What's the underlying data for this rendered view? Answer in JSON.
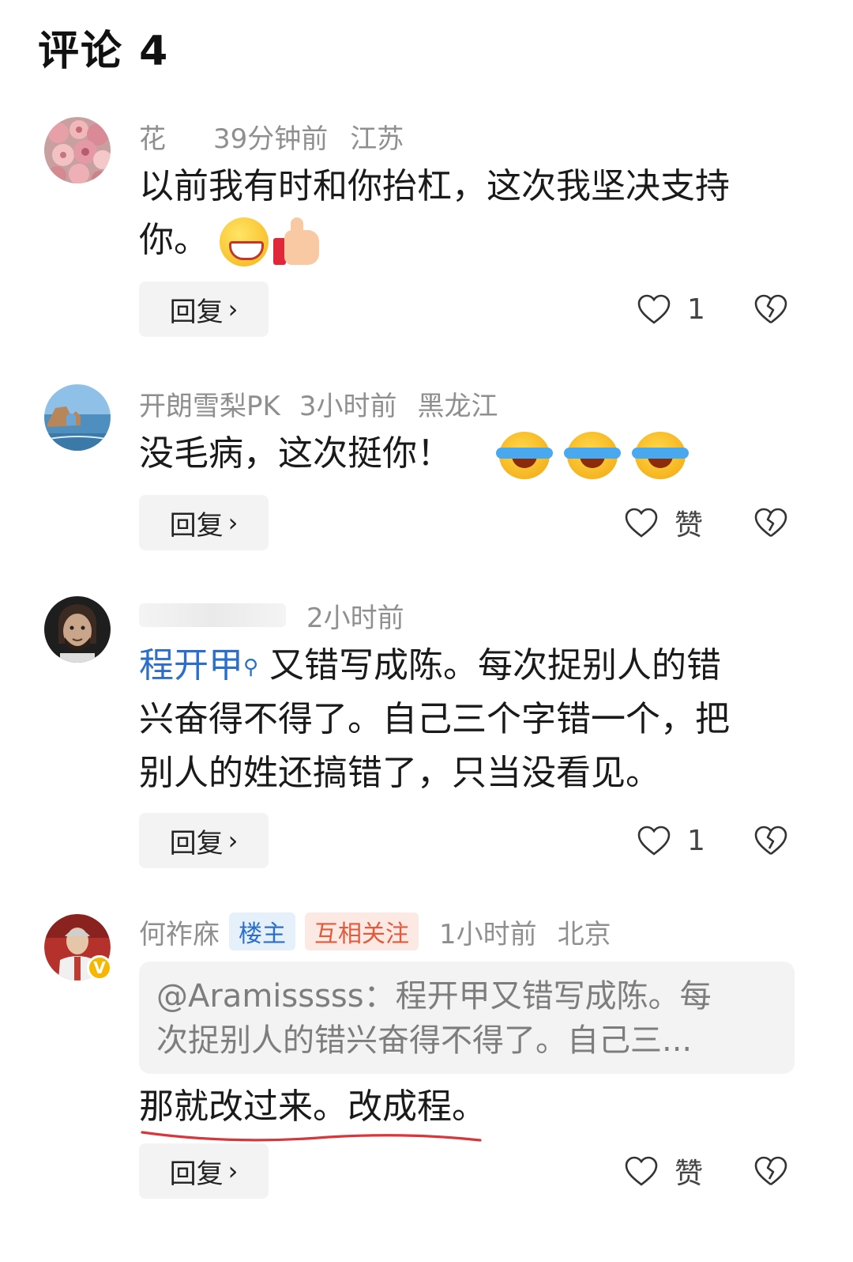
{
  "header": {
    "title": "评论 4"
  },
  "comments": [
    {
      "username": "花",
      "time": "39分钟前",
      "location": "江苏",
      "text_line1": "以前我有时和你抬杠，这次我坚决支持",
      "text_line2": "你。",
      "reply_label": "回复",
      "like_count": "1",
      "emoji": [
        "grin-icon",
        "thumbs-up-icon"
      ]
    },
    {
      "username": "开朗雪梨PK",
      "time": "3小时前",
      "location": "黑龙江",
      "text": "没毛病，这次挺你！",
      "reply_label": "回复",
      "like_count": "赞",
      "emoji": [
        "laugh-cry-icon",
        "laugh-cry-icon",
        "laugh-cry-icon"
      ]
    },
    {
      "username": "",
      "time": "2小时前",
      "mention": "程开甲",
      "text_line1": " 又错写成陈。每次捉别人的错",
      "text_line2": "兴奋得不得了。自己三个字错一个，把",
      "text_line3": "别人的姓还搞错了，只当没看见。",
      "reply_label": "回复",
      "like_count": "1"
    },
    {
      "username": "何祚庥",
      "badge_op": "楼主",
      "badge_mutual": "互相关注",
      "time": "1小时前",
      "location": "北京",
      "quote_line1": "@Aramisssss：程开甲又错写成陈。每",
      "quote_line2": "次捉别人的错兴奋得不得了。自己三...",
      "text": "那就改过来。改成程。",
      "reply_label": "回复",
      "like_count": "赞"
    }
  ],
  "colors": {
    "link_blue": "#2b6fc9",
    "meta_gray": "#8f8f8f",
    "underline_red": "#d8363a",
    "mutual_orange": "#e25a3b"
  }
}
